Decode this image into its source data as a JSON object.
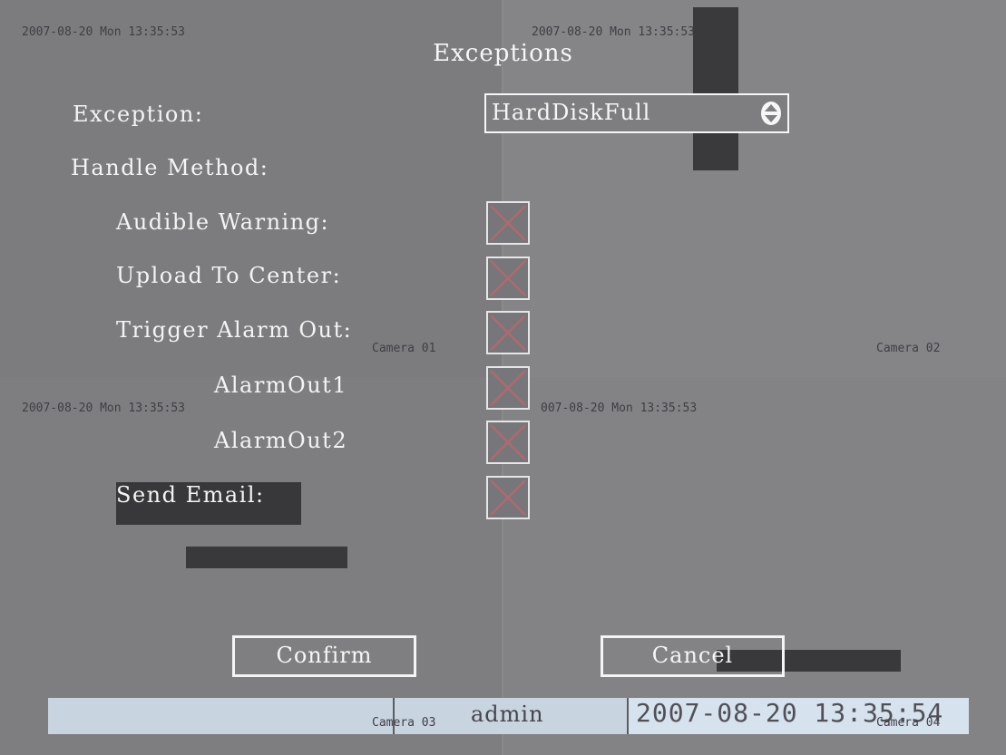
{
  "screen": {
    "title": "Exceptions"
  },
  "overlays": {
    "timestamp_q1": "2007-08-20 Mon 13:35:53",
    "timestamp_q2": "2007-08-20 Mon 13:35:53",
    "timestamp_q3": "2007-08-20 Mon 13:35:53",
    "timestamp_q4": "007-08-20 Mon 13:35:53",
    "camera_01": "Camera 01",
    "camera_02": "Camera 02",
    "camera_03": "Camera 03",
    "camera_04": "Camera 04"
  },
  "form": {
    "exception_label": "Exception:",
    "exception_value": "HardDiskFull",
    "handle_method_label": "Handle Method:",
    "audible_warning_label": "Audible Warning:",
    "upload_to_center_label": "Upload To Center:",
    "trigger_alarm_out_label": "Trigger Alarm Out:",
    "alarm_out1_label": "AlarmOut1",
    "alarm_out2_label": "AlarmOut2",
    "send_email_label": "Send Email:",
    "checkbox_states": {
      "audible_warning": false,
      "upload_to_center": false,
      "trigger_alarm_out": false,
      "alarm_out1": false,
      "alarm_out2": false,
      "send_email": false
    }
  },
  "buttons": {
    "confirm": "Confirm",
    "cancel": "Cancel"
  },
  "statusbar": {
    "user": "admin",
    "datetime": "2007-08-20 13:35:54"
  },
  "icons": {
    "checkbox_mark": "cross-icon",
    "select_arrows": "up-down-arrows-icon"
  },
  "colors": {
    "background": "#807f81",
    "text": "#f4f4f4",
    "checkbox_cross": "#b06a6e",
    "statusbar": "#c8d4e0"
  }
}
